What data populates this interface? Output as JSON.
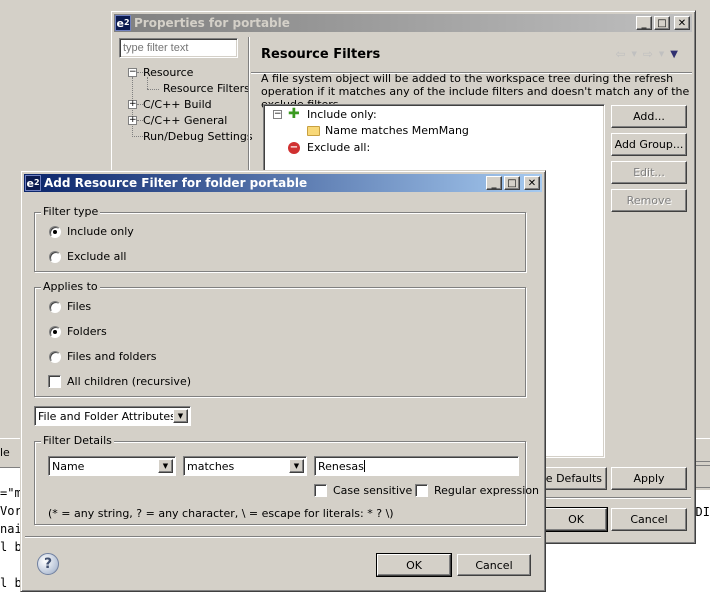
{
  "background_editor": {
    "tab_label": "le",
    "lines": [
      "=\"m",
      "Vor",
      "nai",
      "l b",
      "",
      "l b"
    ],
    "right_fragment": "DI"
  },
  "properties_dialog": {
    "title": "Properties for portable",
    "filter_placeholder": "type filter text",
    "tree": [
      {
        "label": "Resource",
        "expander": "minus"
      },
      {
        "label": "Resource Filters",
        "selected": true
      },
      {
        "label": "C/C++ Build",
        "expander": "plus"
      },
      {
        "label": "C/C++ General",
        "expander": "plus"
      },
      {
        "label": "Run/Debug Settings"
      }
    ],
    "page_title": "Resource Filters",
    "description": "A file system object will be added to the workspace tree during the refresh operation if it matches any of the include filters and doesn't match any of the exclude filters.",
    "filters": {
      "include_label": "Include only:",
      "include_child": "Name matches MemMang",
      "exclude_label": "Exclude all:"
    },
    "buttons": {
      "add": "Add...",
      "add_group": "Add Group...",
      "edit": "Edit...",
      "remove": "Remove",
      "restore_defaults": "re Defaults",
      "apply": "Apply",
      "ok": "OK",
      "cancel": "Cancel"
    }
  },
  "add_filter_dialog": {
    "title": "Add Resource Filter for folder portable",
    "filter_type": {
      "label": "Filter type",
      "options": [
        "Include only",
        "Exclude all"
      ],
      "selected": "Include only"
    },
    "applies_to": {
      "label": "Applies to",
      "options": [
        "Files",
        "Folders",
        "Files and folders"
      ],
      "selected": "Folders",
      "recursive_label": "All children (recursive)",
      "recursive_checked": false
    },
    "attribute_combo": "File and Folder Attributes",
    "filter_details": {
      "label": "Filter Details",
      "attribute": "Name",
      "operator": "matches",
      "value": "Renesas",
      "case_sensitive_label": "Case sensitive",
      "case_sensitive_checked": false,
      "regex_label": "Regular expression",
      "regex_checked": false,
      "hint": "(* = any string, ? = any character, \\ = escape for literals: * ? \\)"
    },
    "buttons": {
      "ok": "OK",
      "cancel": "Cancel"
    }
  }
}
